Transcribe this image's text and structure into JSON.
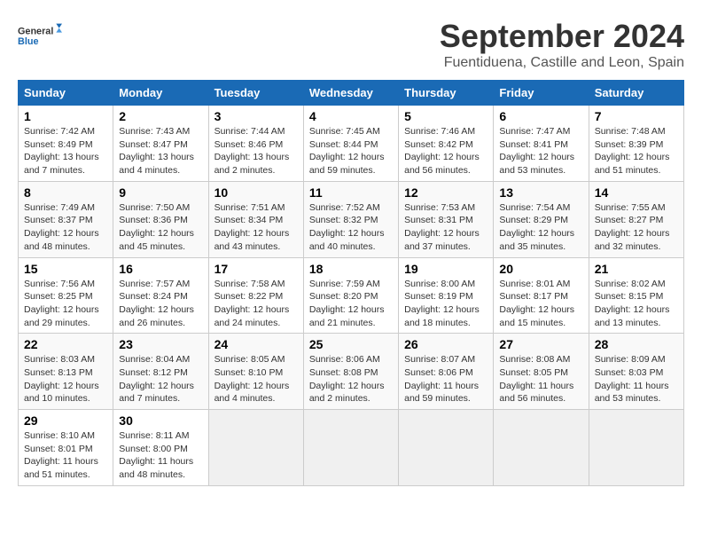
{
  "logo": {
    "line1": "General",
    "line2": "Blue"
  },
  "title": "September 2024",
  "subtitle": "Fuentiduena, Castille and Leon, Spain",
  "days_of_week": [
    "Sunday",
    "Monday",
    "Tuesday",
    "Wednesday",
    "Thursday",
    "Friday",
    "Saturday"
  ],
  "weeks": [
    [
      {
        "day": "1",
        "sunrise": "Sunrise: 7:42 AM",
        "sunset": "Sunset: 8:49 PM",
        "daylight": "Daylight: 13 hours and 7 minutes."
      },
      {
        "day": "2",
        "sunrise": "Sunrise: 7:43 AM",
        "sunset": "Sunset: 8:47 PM",
        "daylight": "Daylight: 13 hours and 4 minutes."
      },
      {
        "day": "3",
        "sunrise": "Sunrise: 7:44 AM",
        "sunset": "Sunset: 8:46 PM",
        "daylight": "Daylight: 13 hours and 2 minutes."
      },
      {
        "day": "4",
        "sunrise": "Sunrise: 7:45 AM",
        "sunset": "Sunset: 8:44 PM",
        "daylight": "Daylight: 12 hours and 59 minutes."
      },
      {
        "day": "5",
        "sunrise": "Sunrise: 7:46 AM",
        "sunset": "Sunset: 8:42 PM",
        "daylight": "Daylight: 12 hours and 56 minutes."
      },
      {
        "day": "6",
        "sunrise": "Sunrise: 7:47 AM",
        "sunset": "Sunset: 8:41 PM",
        "daylight": "Daylight: 12 hours and 53 minutes."
      },
      {
        "day": "7",
        "sunrise": "Sunrise: 7:48 AM",
        "sunset": "Sunset: 8:39 PM",
        "daylight": "Daylight: 12 hours and 51 minutes."
      }
    ],
    [
      {
        "day": "8",
        "sunrise": "Sunrise: 7:49 AM",
        "sunset": "Sunset: 8:37 PM",
        "daylight": "Daylight: 12 hours and 48 minutes."
      },
      {
        "day": "9",
        "sunrise": "Sunrise: 7:50 AM",
        "sunset": "Sunset: 8:36 PM",
        "daylight": "Daylight: 12 hours and 45 minutes."
      },
      {
        "day": "10",
        "sunrise": "Sunrise: 7:51 AM",
        "sunset": "Sunset: 8:34 PM",
        "daylight": "Daylight: 12 hours and 43 minutes."
      },
      {
        "day": "11",
        "sunrise": "Sunrise: 7:52 AM",
        "sunset": "Sunset: 8:32 PM",
        "daylight": "Daylight: 12 hours and 40 minutes."
      },
      {
        "day": "12",
        "sunrise": "Sunrise: 7:53 AM",
        "sunset": "Sunset: 8:31 PM",
        "daylight": "Daylight: 12 hours and 37 minutes."
      },
      {
        "day": "13",
        "sunrise": "Sunrise: 7:54 AM",
        "sunset": "Sunset: 8:29 PM",
        "daylight": "Daylight: 12 hours and 35 minutes."
      },
      {
        "day": "14",
        "sunrise": "Sunrise: 7:55 AM",
        "sunset": "Sunset: 8:27 PM",
        "daylight": "Daylight: 12 hours and 32 minutes."
      }
    ],
    [
      {
        "day": "15",
        "sunrise": "Sunrise: 7:56 AM",
        "sunset": "Sunset: 8:25 PM",
        "daylight": "Daylight: 12 hours and 29 minutes."
      },
      {
        "day": "16",
        "sunrise": "Sunrise: 7:57 AM",
        "sunset": "Sunset: 8:24 PM",
        "daylight": "Daylight: 12 hours and 26 minutes."
      },
      {
        "day": "17",
        "sunrise": "Sunrise: 7:58 AM",
        "sunset": "Sunset: 8:22 PM",
        "daylight": "Daylight: 12 hours and 24 minutes."
      },
      {
        "day": "18",
        "sunrise": "Sunrise: 7:59 AM",
        "sunset": "Sunset: 8:20 PM",
        "daylight": "Daylight: 12 hours and 21 minutes."
      },
      {
        "day": "19",
        "sunrise": "Sunrise: 8:00 AM",
        "sunset": "Sunset: 8:19 PM",
        "daylight": "Daylight: 12 hours and 18 minutes."
      },
      {
        "day": "20",
        "sunrise": "Sunrise: 8:01 AM",
        "sunset": "Sunset: 8:17 PM",
        "daylight": "Daylight: 12 hours and 15 minutes."
      },
      {
        "day": "21",
        "sunrise": "Sunrise: 8:02 AM",
        "sunset": "Sunset: 8:15 PM",
        "daylight": "Daylight: 12 hours and 13 minutes."
      }
    ],
    [
      {
        "day": "22",
        "sunrise": "Sunrise: 8:03 AM",
        "sunset": "Sunset: 8:13 PM",
        "daylight": "Daylight: 12 hours and 10 minutes."
      },
      {
        "day": "23",
        "sunrise": "Sunrise: 8:04 AM",
        "sunset": "Sunset: 8:12 PM",
        "daylight": "Daylight: 12 hours and 7 minutes."
      },
      {
        "day": "24",
        "sunrise": "Sunrise: 8:05 AM",
        "sunset": "Sunset: 8:10 PM",
        "daylight": "Daylight: 12 hours and 4 minutes."
      },
      {
        "day": "25",
        "sunrise": "Sunrise: 8:06 AM",
        "sunset": "Sunset: 8:08 PM",
        "daylight": "Daylight: 12 hours and 2 minutes."
      },
      {
        "day": "26",
        "sunrise": "Sunrise: 8:07 AM",
        "sunset": "Sunset: 8:06 PM",
        "daylight": "Daylight: 11 hours and 59 minutes."
      },
      {
        "day": "27",
        "sunrise": "Sunrise: 8:08 AM",
        "sunset": "Sunset: 8:05 PM",
        "daylight": "Daylight: 11 hours and 56 minutes."
      },
      {
        "day": "28",
        "sunrise": "Sunrise: 8:09 AM",
        "sunset": "Sunset: 8:03 PM",
        "daylight": "Daylight: 11 hours and 53 minutes."
      }
    ],
    [
      {
        "day": "29",
        "sunrise": "Sunrise: 8:10 AM",
        "sunset": "Sunset: 8:01 PM",
        "daylight": "Daylight: 11 hours and 51 minutes."
      },
      {
        "day": "30",
        "sunrise": "Sunrise: 8:11 AM",
        "sunset": "Sunset: 8:00 PM",
        "daylight": "Daylight: 11 hours and 48 minutes."
      },
      null,
      null,
      null,
      null,
      null
    ]
  ]
}
